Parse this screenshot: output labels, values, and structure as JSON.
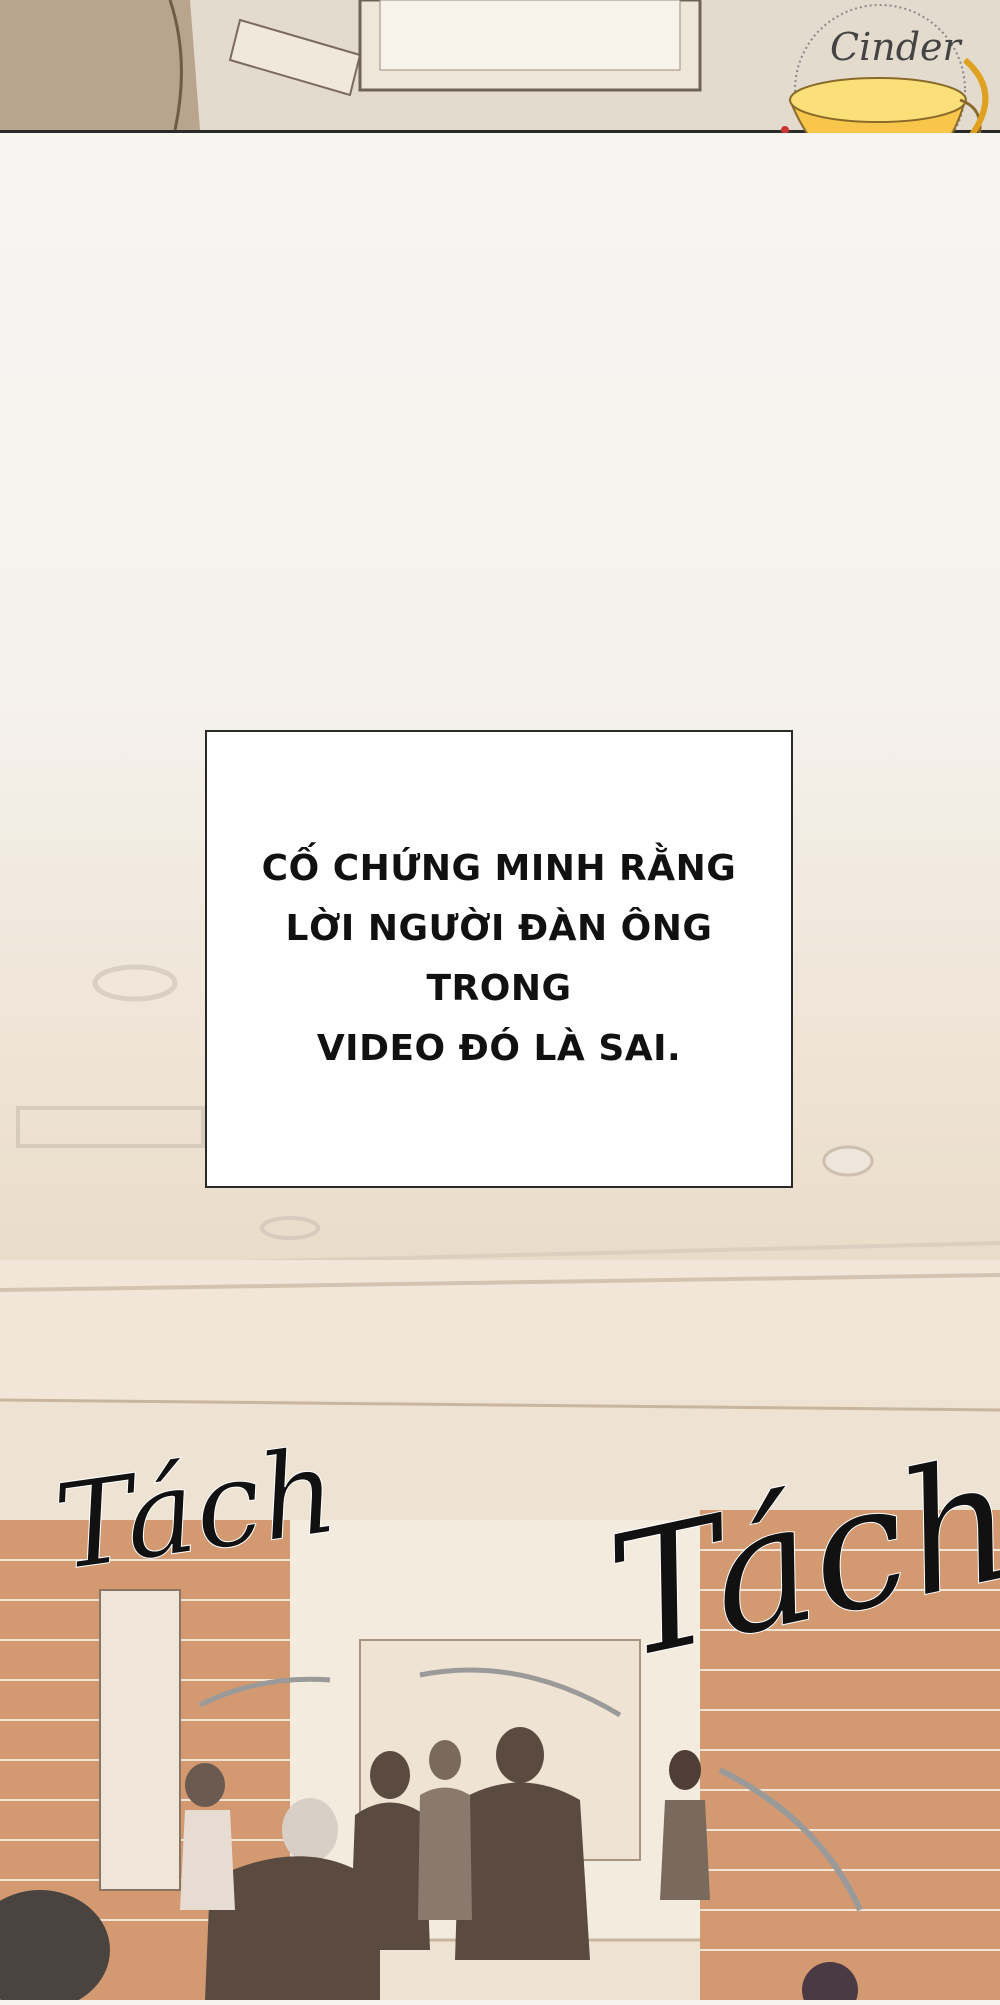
{
  "logo": {
    "text": "Cinder",
    "icon": "tea-cup-logo-icon"
  },
  "caption": {
    "text": "CỐ CHỨNG MINH RẰNG\nLỜI NGƯỜI ĐÀN ÔNG TRONG\nVIDEO ĐÓ LÀ SAI."
  },
  "sound_effects": {
    "left": "Tách",
    "right": "Tách"
  },
  "colors": {
    "background": "#f6f2ec",
    "brick": "#c98a63",
    "outline": "#2b2b2b"
  }
}
